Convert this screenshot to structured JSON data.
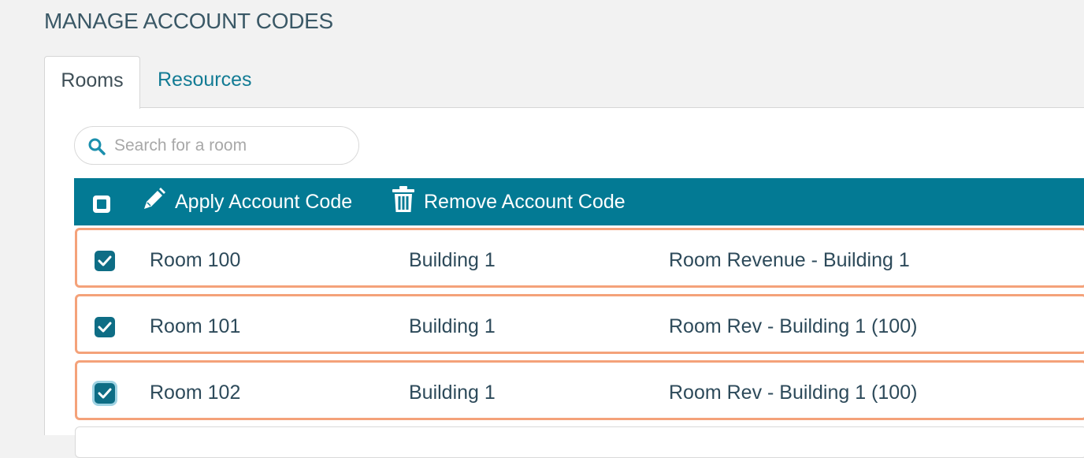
{
  "page": {
    "title": "MANAGE ACCOUNT CODES"
  },
  "tabs": [
    {
      "label": "Rooms",
      "active": true
    },
    {
      "label": "Resources",
      "active": false
    }
  ],
  "search": {
    "placeholder": "Search for a room",
    "value": ""
  },
  "toolbar": {
    "select_all_checked": false,
    "apply_label": "Apply Account Code",
    "remove_label": "Remove Account Code"
  },
  "rows": [
    {
      "checked": true,
      "name": "Room 100",
      "building": "Building 1",
      "account_code": "Room Revenue - Building 1"
    },
    {
      "checked": true,
      "name": "Room 101",
      "building": "Building 1",
      "account_code": "Room Rev - Building 1 (100)"
    },
    {
      "checked": true,
      "name": "Room 102",
      "building": "Building 1",
      "account_code": "Room Rev - Building 1 (100)"
    }
  ],
  "colors": {
    "accent": "#037a94",
    "selected_row_border": "#f4a27a",
    "link": "#127b94"
  }
}
